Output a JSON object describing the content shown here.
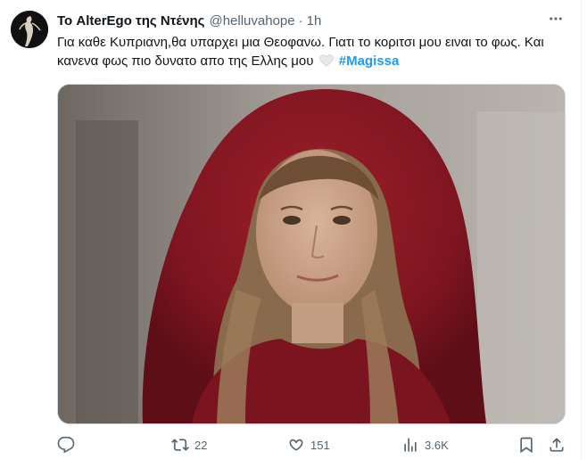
{
  "tweet": {
    "display_name": "Το AlterEgo της Ντένης",
    "handle": "@helluvahope",
    "separator": "·",
    "time": "1h",
    "text_line1": "Για καθε Κυπριανη,θα υπαρχει μια Θεοφανω. Γιατι το κοριτσι μου ειναι το",
    "text_line2": "φως. Και κανενα φως πιο δυνατο απο της Ελλης μου",
    "hashtag": "#Magissa",
    "heart_emoji": "white-heart-emoji",
    "media": "photo of a woman in a red hooded cloak"
  },
  "actions": {
    "reply_icon": "reply-icon",
    "retweet_icon": "retweet-icon",
    "retweet_count": "22",
    "like_icon": "like-icon",
    "like_count": "151",
    "views_icon": "views-icon",
    "views_count": "3.6K",
    "bookmark_icon": "bookmark-icon",
    "share_icon": "share-icon"
  },
  "colors": {
    "text": "#0f1419",
    "secondary": "#536471",
    "hashtag": "#1d9bf0",
    "border": "#cfd9de"
  }
}
